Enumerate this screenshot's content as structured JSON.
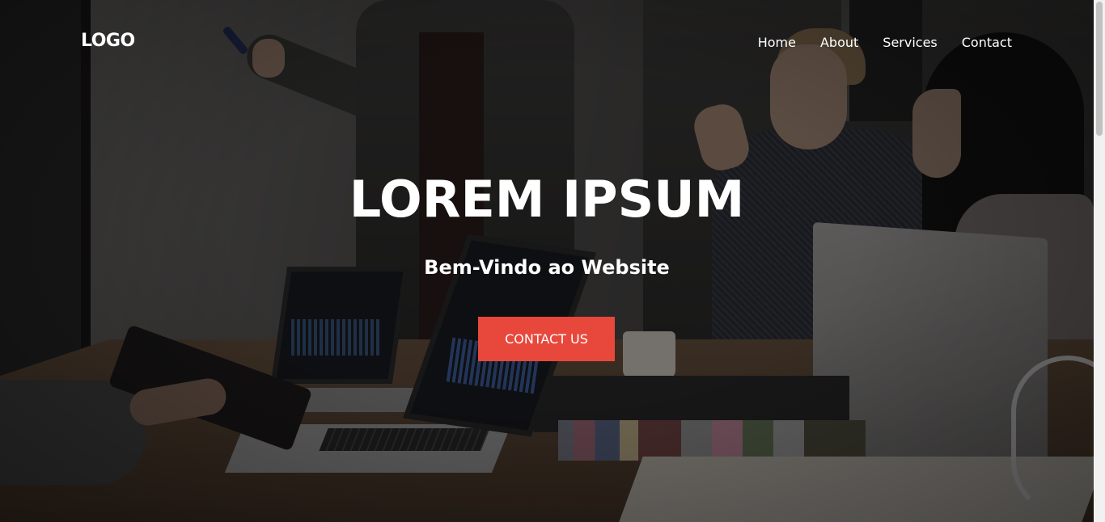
{
  "navbar": {
    "logo": "LOGO",
    "links": [
      {
        "label": "Home"
      },
      {
        "label": "About"
      },
      {
        "label": "Services"
      },
      {
        "label": "Contact"
      }
    ]
  },
  "hero": {
    "title": "LOREM IPSUM",
    "subtitle": "Bem-Vindo ao Website",
    "cta_label": "CONTACT US"
  },
  "colors": {
    "accent": "#e8483b",
    "text": "#ffffff"
  },
  "scrollbar": {
    "position": 0
  }
}
